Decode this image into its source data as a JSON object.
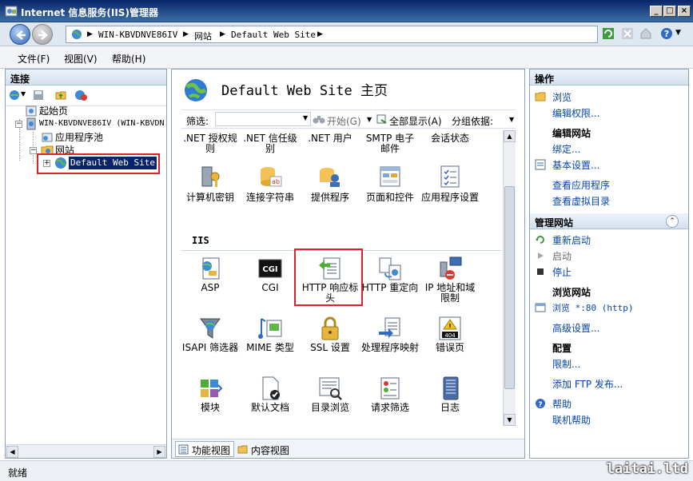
{
  "window": {
    "title": "Internet 信息服务(IIS)管理器",
    "buttons": {
      "minimize": "_",
      "maximize": "□",
      "close": "×"
    }
  },
  "address": {
    "crumbs": [
      "WIN-KBVDNVE86IV",
      "网站",
      "Default Web Site"
    ],
    "icons": [
      "refresh-icon",
      "stop-icon",
      "home-icon",
      "help-icon"
    ]
  },
  "menu": {
    "file": "文件(F)",
    "view": "视图(V)",
    "help": "帮助(H)"
  },
  "left": {
    "title": "连接",
    "tree": {
      "start_page": "起始页",
      "server": "WIN-KBVDNVE86IV (WIN-KBVDN",
      "app_pools": "应用程序池",
      "sites": "网站",
      "selected_site": "Default Web Site"
    }
  },
  "center": {
    "title": "Default Web Site 主页",
    "filter": {
      "label": "筛选:",
      "start": "开始(G)",
      "show_all": "全部显示(A)",
      "group_by": "分组依据:"
    },
    "row0": [
      ".NET 授权规则",
      ".NET 信任级别",
      ".NET 用户",
      "SMTP 电子邮件",
      "会话状态"
    ],
    "row1": [
      "计算机密钥",
      "连接字符串",
      "提供程序",
      "页面和控件",
      "应用程序设置"
    ],
    "section_iis": "IIS",
    "row2": [
      "ASP",
      "CGI",
      "HTTP 响应标头",
      "HTTP 重定向",
      "IP 地址和域限制"
    ],
    "row3": [
      "ISAPI 筛选器",
      "MIME 类型",
      "SSL 设置",
      "处理程序映射",
      "错误页"
    ],
    "row4": [
      "模块",
      "默认文档",
      "目录浏览",
      "请求筛选",
      "日志"
    ],
    "cgi_icon_text": "CGI",
    "err_icon_text": "404",
    "tabs": {
      "features": "功能视图",
      "content": "内容视图"
    }
  },
  "right": {
    "title": "操作",
    "explore": "浏览",
    "edit_perms": "编辑权限...",
    "edit_site_hdr": "编辑网站",
    "bindings": "绑定...",
    "basic_settings": "基本设置...",
    "view_apps": "查看应用程序",
    "view_vdirs": "查看虚拟目录",
    "manage_hdr": "管理网站",
    "restart": "重新启动",
    "start": "启动",
    "stop": "停止",
    "browse_hdr": "浏览网站",
    "browse_80": "浏览 *:80 (http)",
    "advanced": "高级设置...",
    "config_hdr": "配置",
    "limits": "限制...",
    "add_ftp": "添加 FTP 发布...",
    "help": "帮助",
    "online_help": "联机帮助"
  },
  "status": {
    "text": "就绪",
    "watermark": "laitai.ltd"
  }
}
